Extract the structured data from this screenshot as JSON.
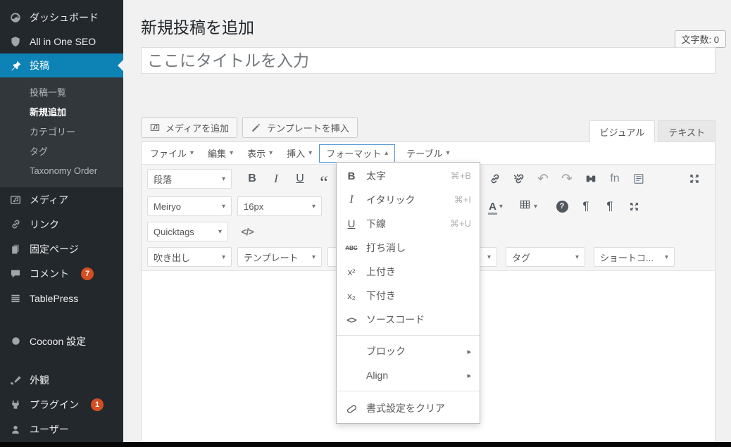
{
  "sidebar": {
    "dashboard": "ダッシュボード",
    "aioseo": "All in One SEO",
    "posts": "投稿",
    "submenu": {
      "all_posts": "投稿一覧",
      "add_new": "新規追加",
      "categories": "カテゴリー",
      "tags": "タグ",
      "taxonomy_order": "Taxonomy Order"
    },
    "media": "メディア",
    "links": "リンク",
    "pages": "固定ページ",
    "comments": "コメント",
    "comments_badge": "7",
    "tablepress": "TablePress",
    "cocoon": "Cocoon 設定",
    "appearance": "外観",
    "plugins": "プラグイン",
    "plugins_badge": "1",
    "users": "ユーザー"
  },
  "header": {
    "title": "新規投稿を追加",
    "char_count": "文字数: 0"
  },
  "title_field": {
    "placeholder": "ここにタイトルを入力"
  },
  "media_row": {
    "add_media": "メディアを追加",
    "insert_template": "テンプレートを挿入"
  },
  "tabs": {
    "visual": "ビジュアル",
    "text": "テキスト"
  },
  "menubar": {
    "file": "ファイル",
    "edit": "編集",
    "view": "表示",
    "insert": "挿入",
    "format": "フォーマット",
    "table": "テーブル"
  },
  "toolbar": {
    "block_select": "段落",
    "font_select": "Meiryo",
    "fontsize_select": "16px",
    "quicktags_select": "Quicktags",
    "speech_select": "吹き出し",
    "template_select": "テンプレート",
    "covered_select_1": "",
    "covered_select_2": "",
    "tag_select": "タグ",
    "shortcode_select": "ショートコ..."
  },
  "format_menu": {
    "bold": {
      "label": "太字",
      "shortcut": "⌘+B"
    },
    "italic": {
      "label": "イタリック",
      "shortcut": "⌘+I"
    },
    "underline": {
      "label": "下線",
      "shortcut": "⌘+U"
    },
    "strikethrough": {
      "label": "打ち消し"
    },
    "superscript": {
      "label": "上付き"
    },
    "subscript": {
      "label": "下付き"
    },
    "source_code": {
      "label": "ソースコード"
    },
    "blocks": {
      "label": "ブロック"
    },
    "align": {
      "label": "Align"
    },
    "clear": {
      "label": "書式設定をクリア"
    }
  },
  "icons": {
    "caret_down": "▾",
    "caret_up": "▴",
    "submenu_arrow": "▸",
    "bold": "B",
    "italic": "I",
    "underline": "U",
    "quote": "“",
    "strikethrough": "ABC",
    "superscript": "x²",
    "subscript": "x₂",
    "undo": "↶",
    "redo": "↷",
    "fn": "fn",
    "code_tag": "</>",
    "source_code": "<>",
    "pilcrow": "¶",
    "text_color": "A",
    "help": "?"
  },
  "colors": {
    "sidebar_bg": "#23282d",
    "submenu_bg": "#32373c",
    "accent_active": "#0d82b5",
    "badge": "#d54e21",
    "open_menu_border": "#4f94d4",
    "toolbar_bg": "#f5f5f5"
  }
}
